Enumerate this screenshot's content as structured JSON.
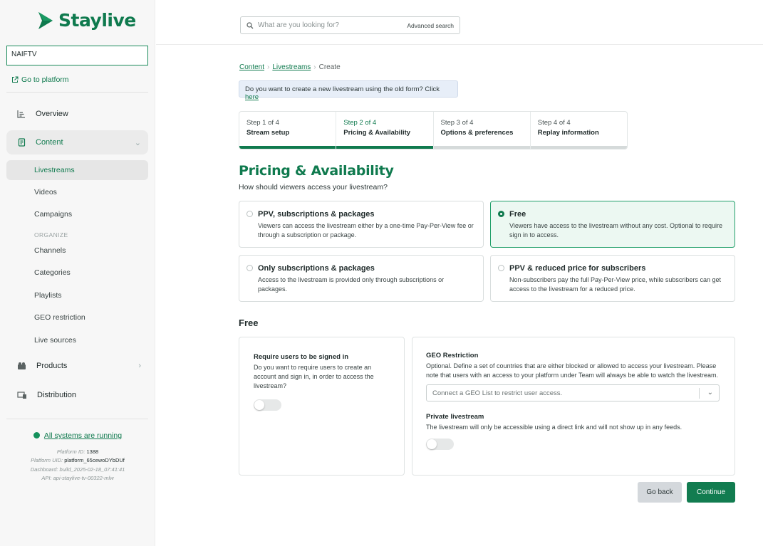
{
  "brand": {
    "name": "Staylive",
    "accent": "#0f7a4e"
  },
  "sidebar": {
    "tenant": "NAIFTV",
    "goto_platform": "Go to platform",
    "nav": [
      {
        "label": "Overview",
        "icon": "overview-icon"
      },
      {
        "label": "Content",
        "icon": "content-icon",
        "expanded": true
      },
      {
        "label": "Products",
        "icon": "products-icon"
      },
      {
        "label": "Distribution",
        "icon": "distribution-icon"
      }
    ],
    "content_items": [
      "Livestreams",
      "Videos",
      "Campaigns"
    ],
    "organize_heading": "ORGANIZE",
    "organize_items": [
      "Channels",
      "Categories",
      "Playlists",
      "GEO restriction",
      "Live sources"
    ],
    "active_item": "Livestreams",
    "status": "All systems are running",
    "meta": {
      "platform_id_label": "Platform ID:",
      "platform_id": "1388",
      "platform_uid_label": "Platform UID:",
      "platform_uid": "platform_65cewoDYbDUf",
      "dashboard": "Dashboard: build_2025-02-18_07:41:41",
      "api": "API: api-staylive-tv-00322-mlw"
    }
  },
  "search": {
    "placeholder": "What are you looking for?",
    "advanced": "Advanced search"
  },
  "breadcrumb": {
    "items": [
      "Content",
      "Livestreams"
    ],
    "current": "Create"
  },
  "notice": {
    "text": "Do you want to create a new livestream using the old form? Click ",
    "link": "here"
  },
  "steps": [
    {
      "num": "Step 1 of 4",
      "title": "Stream setup",
      "state": "done"
    },
    {
      "num": "Step 2 of 4",
      "title": "Pricing & Availability",
      "state": "current"
    },
    {
      "num": "Step 3 of 4",
      "title": "Options & preferences",
      "state": "todo"
    },
    {
      "num": "Step 4 of 4",
      "title": "Replay information",
      "state": "todo"
    }
  ],
  "page": {
    "title": "Pricing & Availability",
    "subtitle": "How should viewers access your livestream?"
  },
  "options": [
    {
      "title": "PPV, subscriptions & packages",
      "desc": "Viewers can access the livestream either by a one-time Pay-Per-View fee or through a subscription or package.",
      "selected": false
    },
    {
      "title": "Free",
      "desc": "Viewers have access to the livestream without any cost. Optional to require sign in to access.",
      "selected": true
    },
    {
      "title": "Only subscriptions & packages",
      "desc": "Access to the livestream is provided only through subscriptions or packages.",
      "selected": false
    },
    {
      "title": "PPV & reduced price for subscribers",
      "desc": "Non-subscribers pay the full Pay-Per-View price, while subscribers can get access to the livestream for a reduced price.",
      "selected": false
    }
  ],
  "section": {
    "title": "Free",
    "signin": {
      "title": "Require users to be signed in",
      "desc": "Do you want to require users to create an account and sign in, in order to access the livestream?",
      "on": false
    },
    "geo": {
      "title": "GEO Restriction",
      "desc": "Optional. Define a set of countries that are either blocked or allowed to access your livestream. Please note that users with an access to your platform under Team will always be able to watch the livestream.",
      "placeholder": "Connect a GEO List to restrict user access."
    },
    "private": {
      "title": "Private livestream",
      "desc": "The livestream will only be accessible using a direct link and will not show up in any feeds.",
      "on": false
    }
  },
  "buttons": {
    "back": "Go back",
    "continue": "Continue"
  }
}
